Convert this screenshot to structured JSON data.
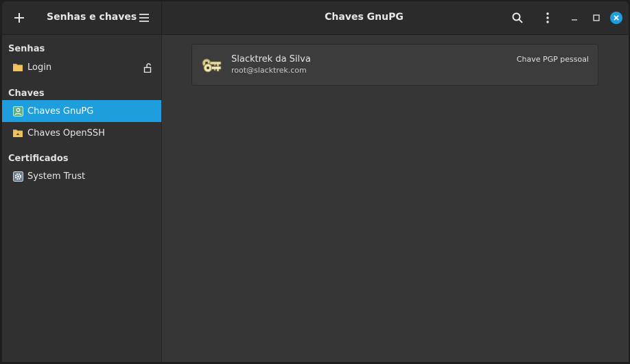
{
  "header": {
    "app_title": "Senhas e chaves",
    "view_title": "Chaves GnuPG",
    "icons": {
      "add": "plus-icon",
      "menu": "hamburger-menu-icon",
      "search": "search-icon",
      "more": "kebab-menu-icon",
      "minimize": "minimize-icon",
      "maximize": "maximize-icon",
      "close": "close-icon"
    }
  },
  "sidebar": {
    "sections": [
      {
        "label": "Senhas",
        "items": [
          {
            "label": "Login",
            "icon": "folder-icon",
            "trailing_icon": "unlocked-padlock-icon"
          }
        ]
      },
      {
        "label": "Chaves",
        "items": [
          {
            "label": "Chaves GnuPG",
            "icon": "gnupg-keyring-icon",
            "selected": true
          },
          {
            "label": "Chaves OpenSSH",
            "icon": "ssh-folder-icon"
          }
        ]
      },
      {
        "label": "Certificados",
        "items": [
          {
            "label": "System Trust",
            "icon": "certificate-gear-icon"
          }
        ]
      }
    ]
  },
  "keys": [
    {
      "name": "Slacktrek da Silva",
      "email": "root@slacktrek.com",
      "type": "Chave PGP pessoal",
      "icon": "key-pair-icon"
    }
  ],
  "colors": {
    "accent": "#1f9ede",
    "close_button": "#1f9ede",
    "window_bg": "#363636",
    "sidebar_bg": "#303030",
    "headerbar_bg": "#2b2b2b",
    "folder": "#e8b04a"
  }
}
